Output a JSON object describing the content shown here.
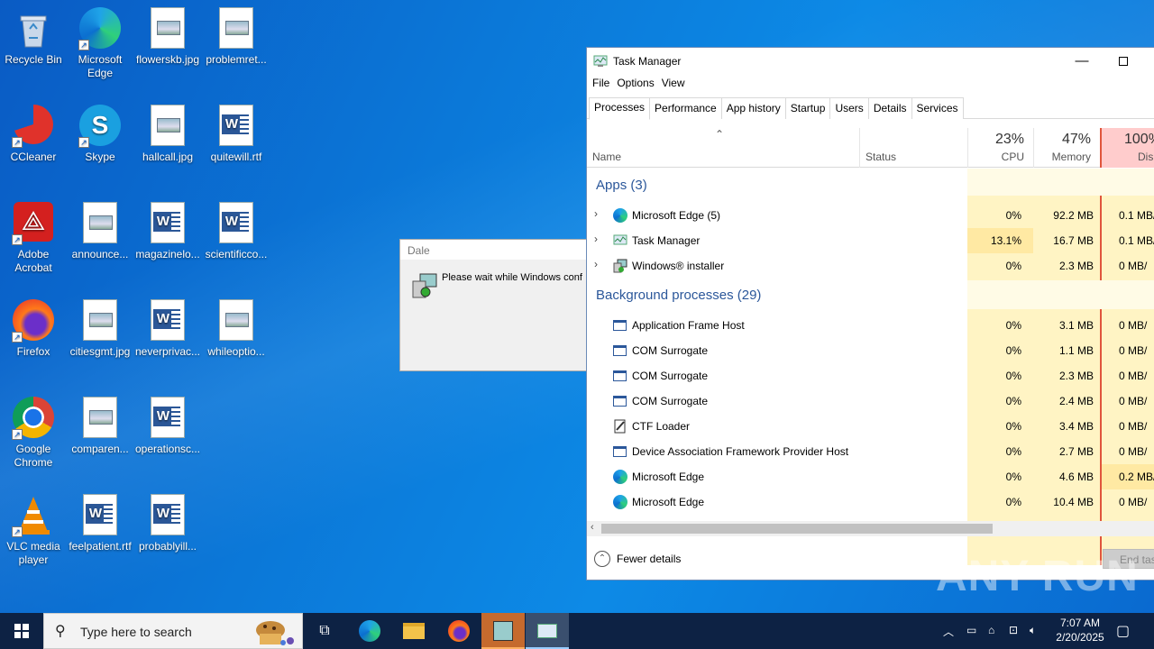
{
  "desktop": {
    "icons": [
      {
        "label": "Recycle Bin"
      },
      {
        "label": "Microsoft Edge"
      },
      {
        "label": "flowerskb.jpg"
      },
      {
        "label": "problemret..."
      },
      {
        "label": "CCleaner"
      },
      {
        "label": "Skype"
      },
      {
        "label": "hallcall.jpg"
      },
      {
        "label": "quitewill.rtf"
      },
      {
        "label": "Adobe Acrobat"
      },
      {
        "label": "announce..."
      },
      {
        "label": "magazinelo..."
      },
      {
        "label": "scientificco..."
      },
      {
        "label": "Firefox"
      },
      {
        "label": "citiesgmt.jpg"
      },
      {
        "label": "neverprivac..."
      },
      {
        "label": "whileoptio..."
      },
      {
        "label": "Google Chrome"
      },
      {
        "label": "comparen..."
      },
      {
        "label": "operationsc..."
      },
      {
        "label": "VLC media player"
      },
      {
        "label": "feelpatient.rtf"
      },
      {
        "label": "probablyill..."
      }
    ]
  },
  "dialog": {
    "title": "Dale",
    "message": "Please wait while Windows conf"
  },
  "task_manager": {
    "title": "Task Manager",
    "menu": [
      "File",
      "Options",
      "View"
    ],
    "tabs": [
      "Processes",
      "Performance",
      "App history",
      "Startup",
      "Users",
      "Details",
      "Services"
    ],
    "columns": {
      "name": "Name",
      "status": "Status",
      "cpu_pct": "23%",
      "cpu": "CPU",
      "mem_pct": "47%",
      "mem": "Memory",
      "disk_pct": "100%",
      "disk": "Dis"
    },
    "apps_header": "Apps (3)",
    "apps": [
      {
        "name": "Microsoft Edge (5)",
        "cpu": "0%",
        "mem": "92.2 MB",
        "disk": "0.1 MB/"
      },
      {
        "name": "Task Manager",
        "cpu": "13.1%",
        "mem": "16.7 MB",
        "disk": "0.1 MB/"
      },
      {
        "name": "Windows® installer",
        "cpu": "0%",
        "mem": "2.3 MB",
        "disk": "0 MB/"
      }
    ],
    "bg_header": "Background processes (29)",
    "background": [
      {
        "name": "Application Frame Host",
        "cpu": "0%",
        "mem": "3.1 MB",
        "disk": "0 MB/"
      },
      {
        "name": "COM Surrogate",
        "cpu": "0%",
        "mem": "1.1 MB",
        "disk": "0 MB/"
      },
      {
        "name": "COM Surrogate",
        "cpu": "0%",
        "mem": "2.3 MB",
        "disk": "0 MB/"
      },
      {
        "name": "COM Surrogate",
        "cpu": "0%",
        "mem": "2.4 MB",
        "disk": "0 MB/"
      },
      {
        "name": "CTF Loader",
        "cpu": "0%",
        "mem": "3.4 MB",
        "disk": "0 MB/"
      },
      {
        "name": "Device Association Framework Provider Host",
        "cpu": "0%",
        "mem": "2.7 MB",
        "disk": "0 MB/"
      },
      {
        "name": "Microsoft Edge",
        "cpu": "0%",
        "mem": "4.6 MB",
        "disk": "0.2 MB/"
      },
      {
        "name": "Microsoft Edge",
        "cpu": "0%",
        "mem": "10.4 MB",
        "disk": "0 MB/"
      }
    ],
    "fewer_details": "Fewer details",
    "end_task": "End tas"
  },
  "taskbar": {
    "search_placeholder": "Type here to search",
    "time": "7:07 AM",
    "date": "2/20/2025"
  },
  "watermark": "ANY RUN"
}
